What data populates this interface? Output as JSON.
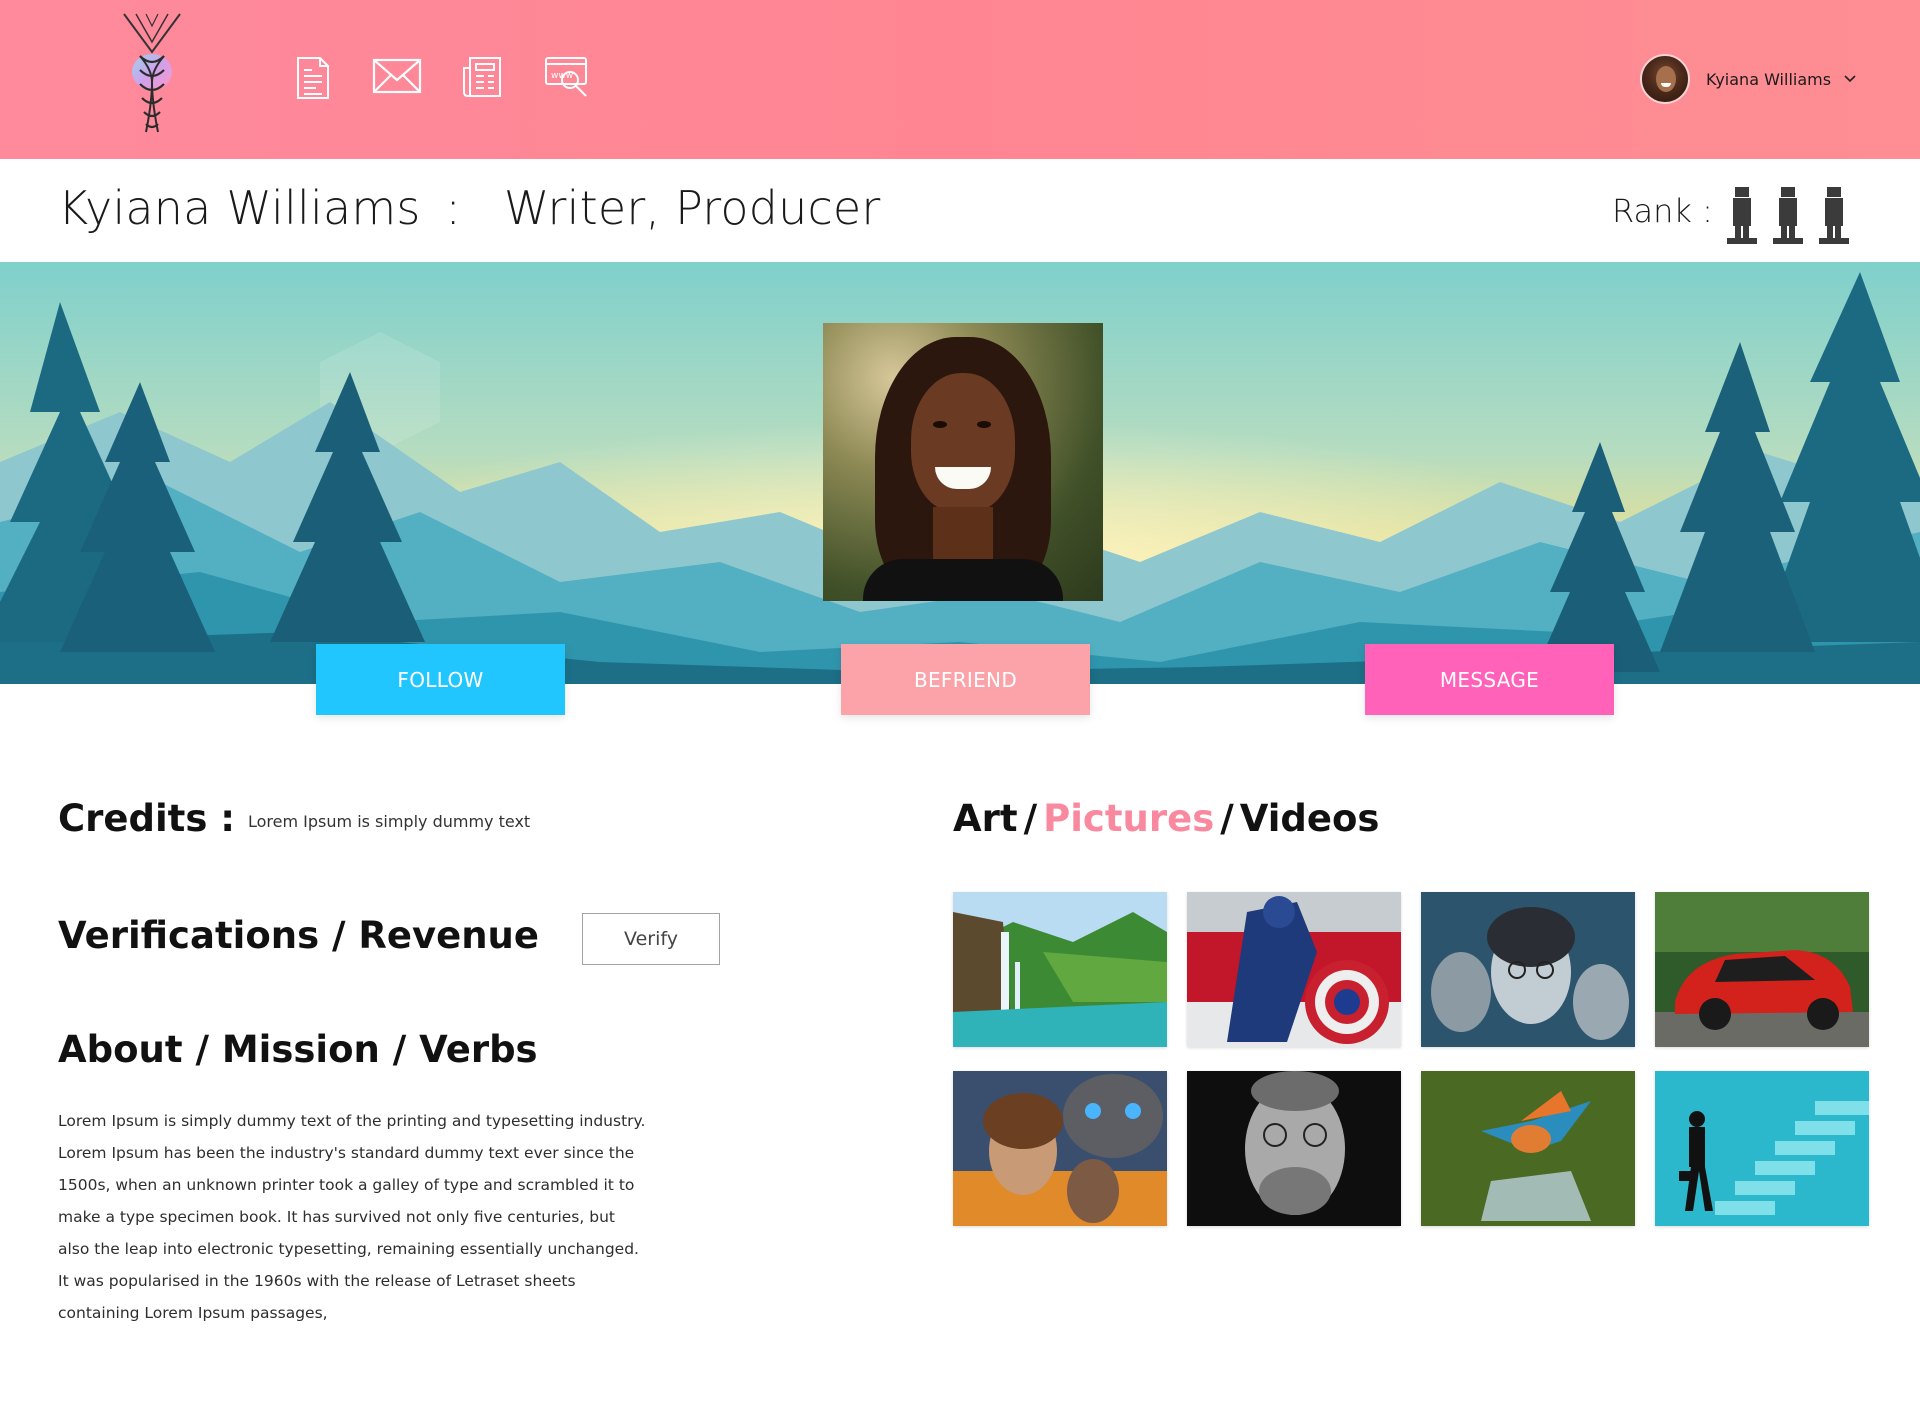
{
  "header": {
    "nav_icons": [
      "document-icon",
      "mail-icon",
      "newspaper-icon",
      "www-search-icon"
    ],
    "user": {
      "name": "Kyiana Williams",
      "avatar": "avatar"
    }
  },
  "title": {
    "name": "Kyiana Williams",
    "separator": ":",
    "roles": "Writer, Producer",
    "rank_label": "Rank :",
    "rank_count": 3
  },
  "actions": {
    "follow": "FOLLOW",
    "befriend": "BEFRIEND",
    "message": "MESSAGE"
  },
  "credits": {
    "heading": "Credits :",
    "text": "Lorem Ipsum is simply dummy text"
  },
  "verifications": {
    "heading": "Verifications / Revenue",
    "button": "Verify"
  },
  "about": {
    "heading": "About / Mission / Verbs",
    "lines": [
      "Lorem Ipsum is simply dummy text of the printing and typesetting industry.",
      "Lorem Ipsum has been the industry's standard dummy text ever since the",
      "1500s, when an unknown printer took a galley of type and scrambled it to",
      "make a type specimen book. It has survived not only five centuries, but",
      "also the leap into electronic typesetting, remaining essentially unchanged.",
      "It was popularised in the 1960s with the release of Letraset sheets",
      "containing Lorem Ipsum passages,"
    ]
  },
  "gallery": {
    "heading_part1": "Art",
    "heading_part2": "Pictures",
    "heading_part3": "Videos",
    "slash": "/",
    "thumbnails": [
      "waterfall-image",
      "captain-america-image",
      "harry-potter-image",
      "red-car-image",
      "transformers-movie-image",
      "portrait-man-image",
      "kingfisher-image",
      "stairs-businessman-image"
    ]
  },
  "colors": {
    "header_gradient_start": "#fe8a9c",
    "follow": "#22c6ff",
    "befriend": "#fca3aa",
    "message": "#ff62b8",
    "accent_text": "#f9899f"
  }
}
